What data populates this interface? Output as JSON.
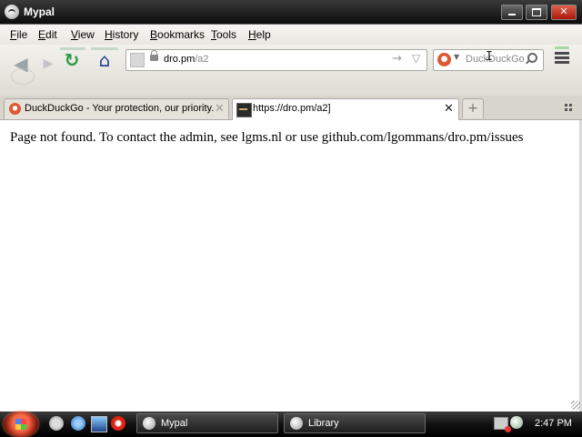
{
  "window": {
    "title": "Mypal",
    "minimize_label": "",
    "maximize_label": "",
    "close_label": "✕"
  },
  "menubar": {
    "items": [
      "File",
      "Edit",
      "View",
      "History",
      "Bookmarks",
      "Tools",
      "Help"
    ]
  },
  "navbar": {
    "back_icon": "back-arrow-icon",
    "forward_icon": "forward-arrow-icon",
    "reload_icon": "reload-icon",
    "home_icon": "home-icon",
    "back_glyph": "◀",
    "forward_glyph": "▶",
    "reload_glyph": "↻",
    "home_glyph": "⌂",
    "url": {
      "domain": "dro.pm",
      "path": "/a2"
    },
    "go_glyph": "→",
    "dropmarker_glyph": "▽",
    "search": {
      "placeholder": "DuckDuckGo",
      "engine_icon": "duckduckgo-icon"
    },
    "cursor_glyph": "I"
  },
  "tabs": [
    {
      "title": "DuckDuckGo - Your protection, our priority.",
      "active": false,
      "close": "✕"
    },
    {
      "title": "https://dro.pm/a2]",
      "active": true,
      "close": "✕"
    }
  ],
  "new_tab_label": "+",
  "content": {
    "message": "Page not found. To contact the admin, see lgms.nl or use github.com/lgommans/dro.pm/issues"
  },
  "taskbar": {
    "buttons": [
      {
        "label": "Mypal",
        "icon": "mypal-icon"
      },
      {
        "label": "Library",
        "icon": "mypal-icon"
      }
    ],
    "clock": "2:47 PM"
  },
  "colors": {
    "titlebar": "#0c0c0c",
    "close_button": "#c8301a",
    "reload_green": "#2a9a4a",
    "home_blue": "#1a3f9a",
    "ddg_orange": "#de5833"
  }
}
